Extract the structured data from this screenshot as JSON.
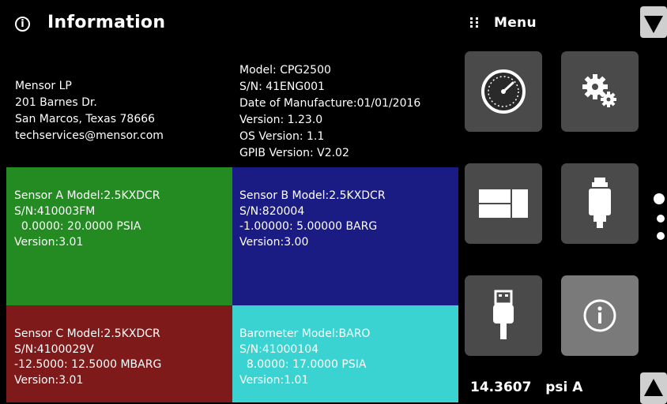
{
  "header": {
    "title": "Information",
    "info_icon_glyph": "i"
  },
  "company": {
    "lines": [
      "Mensor LP",
      "201 Barnes Dr.",
      "San Marcos, Texas 78666",
      "techservices@mensor.com"
    ]
  },
  "device": {
    "lines": [
      "Model: CPG2500",
      "S/N: 41ENG001",
      "Date of Manufacture:01/01/2016",
      "Version: 1.23.0",
      "OS Version: 1.1",
      "GPIB Version:  V2.02"
    ]
  },
  "sensors": {
    "a": {
      "color": "#238b21",
      "lines": [
        "Sensor A Model:2.5KXDCR",
        "S/N:410003FM",
        "  0.0000: 20.0000 PSIA",
        "Version:3.01"
      ]
    },
    "b": {
      "color": "#1b1c83",
      "lines": [
        "Sensor B Model:2.5KXDCR",
        "S/N:820004",
        "-1.00000: 5.00000 BARG",
        "Version:3.00"
      ]
    },
    "c": {
      "color": "#7f1a1a",
      "lines": [
        "Sensor C Model:2.5KXDCR",
        "S/N:4100029V",
        "-12.5000: 12.5000 MBARG",
        "Version:3.01"
      ]
    },
    "barometer": {
      "color": "#3ad3d2",
      "lines": [
        "Barometer Model:BARO",
        "S/N:41000104",
        "  8.0000: 17.0000 PSIA",
        "Version:1.01"
      ]
    }
  },
  "menu": {
    "label": "Menu",
    "tiles": [
      {
        "icon": "gauge-icon"
      },
      {
        "icon": "gears-icon"
      },
      {
        "icon": "display-layout-icon"
      },
      {
        "icon": "sensor-transducer-icon"
      },
      {
        "icon": "usb-icon"
      },
      {
        "icon": "info-icon",
        "active": true
      }
    ],
    "page_indicator": {
      "pages": 3,
      "current": 1
    }
  },
  "status": {
    "value": "14.3607",
    "unit": "psi A"
  }
}
